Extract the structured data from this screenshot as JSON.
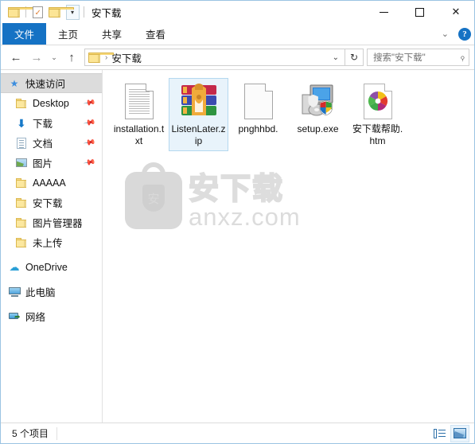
{
  "window": {
    "title": "安下载",
    "qat": [
      {
        "name": "folder-icon",
        "label": ""
      },
      {
        "name": "properties-icon",
        "label": ""
      },
      {
        "name": "new-folder-icon",
        "label": ""
      },
      {
        "name": "customize-qat-dropdown",
        "label": "▾"
      }
    ],
    "controls": {
      "minimize": "—",
      "maximize": "□",
      "close": "✕"
    }
  },
  "ribbon": {
    "tabs": [
      {
        "label": "文件",
        "active": true
      },
      {
        "label": "主页",
        "active": false
      },
      {
        "label": "共享",
        "active": false
      },
      {
        "label": "查看",
        "active": false
      }
    ],
    "collapse_chevron": "⌄",
    "help_label": "?"
  },
  "addressbar": {
    "back": "←",
    "forward": "→",
    "recent": "⌄",
    "up": "↑",
    "crumb_separator": "›",
    "path": "安下载",
    "dropdown": "⌄",
    "refresh": "↻"
  },
  "search": {
    "placeholder": "搜索\"安下载\"",
    "icon": "⌕"
  },
  "sidebar": {
    "items": [
      {
        "label": "快速访问",
        "icon": "star-icon",
        "selected": true,
        "pinned": false,
        "indent": 0
      },
      {
        "label": "Desktop",
        "icon": "folder-icon",
        "selected": false,
        "pinned": true,
        "indent": 1
      },
      {
        "label": "下载",
        "icon": "download-icon",
        "selected": false,
        "pinned": true,
        "indent": 1
      },
      {
        "label": "文档",
        "icon": "documents-icon",
        "selected": false,
        "pinned": true,
        "indent": 1
      },
      {
        "label": "图片",
        "icon": "pictures-icon",
        "selected": false,
        "pinned": true,
        "indent": 1
      },
      {
        "label": "AAAAA",
        "icon": "folder-icon",
        "selected": false,
        "pinned": false,
        "indent": 1
      },
      {
        "label": "安下载",
        "icon": "folder-icon",
        "selected": false,
        "pinned": false,
        "indent": 1
      },
      {
        "label": "图片管理器",
        "icon": "folder-icon",
        "selected": false,
        "pinned": false,
        "indent": 1
      },
      {
        "label": "未上传",
        "icon": "folder-icon",
        "selected": false,
        "pinned": false,
        "indent": 1
      },
      {
        "label": "OneDrive",
        "icon": "cloud-icon",
        "selected": false,
        "pinned": false,
        "indent": 0
      },
      {
        "label": "此电脑",
        "icon": "this-pc-icon",
        "selected": false,
        "pinned": false,
        "indent": 0
      },
      {
        "label": "网络",
        "icon": "network-icon",
        "selected": false,
        "pinned": false,
        "indent": 0
      }
    ]
  },
  "files": [
    {
      "name": "installation.txt",
      "type": "text-file-icon",
      "selected": false
    },
    {
      "name": "ListenLater.zip",
      "type": "winrar-archive-icon",
      "selected": true
    },
    {
      "name": "pnghhbd.",
      "type": "blank-file-icon",
      "selected": false
    },
    {
      "name": "setup.exe",
      "type": "setup-application-icon",
      "selected": false
    },
    {
      "name": "安下载帮助.htm",
      "type": "html-file-icon",
      "selected": false
    }
  ],
  "watermark": {
    "cn": "安下载",
    "en": "anxz.com",
    "badge": "安"
  },
  "statusbar": {
    "count_text": "5 个项目",
    "views": [
      {
        "name": "details-view-button",
        "active": false
      },
      {
        "name": "large-icons-view-button",
        "active": true
      }
    ]
  },
  "colors": {
    "accent": "#1572c4",
    "selection": "#e8f3fb",
    "selection_border": "#b4d8ef",
    "window_border": "#9bc4e2",
    "sidebar_selected": "#dcdcdc"
  }
}
